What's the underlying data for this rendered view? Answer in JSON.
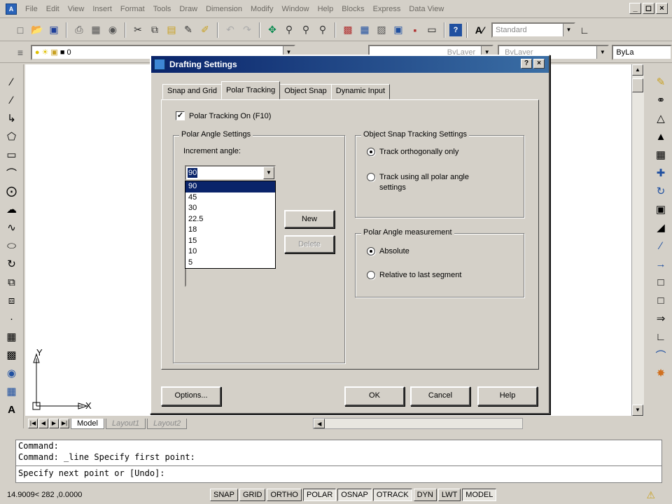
{
  "menu": {
    "items": [
      "File",
      "Edit",
      "View",
      "Insert",
      "Format",
      "Tools",
      "Draw",
      "Dimension",
      "Modify",
      "Window",
      "Help",
      "Blocks",
      "Express",
      "Data View"
    ]
  },
  "window_buttons": [
    "_",
    "&#9723;",
    "×"
  ],
  "toolbar": {
    "text_style_value": "Standard"
  },
  "layers": {
    "layer_name": "0",
    "color_value": "ByLayer",
    "linetype_value": "ByLayer",
    "lineweight_value": "ByLa"
  },
  "ucs": {
    "y_label": "Y",
    "x_label": "X"
  },
  "layout_tabs": [
    {
      "label": "Model",
      "active": true
    },
    {
      "label": "Layout1",
      "active": false
    },
    {
      "label": "Layout2",
      "active": false
    }
  ],
  "command": {
    "lines": [
      "Command:",
      "Command: _line Specify first point:"
    ],
    "prompt": "Specify next point or [Undo]:"
  },
  "status": {
    "coords": "14.9009< 282   ,0.0000",
    "buttons": [
      {
        "label": "SNAP",
        "on": false
      },
      {
        "label": "GRID",
        "on": false
      },
      {
        "label": "ORTHO",
        "on": false
      },
      {
        "label": "POLAR",
        "on": true
      },
      {
        "label": "OSNAP",
        "on": true
      },
      {
        "label": "OTRACK",
        "on": true
      },
      {
        "label": "DYN",
        "on": false
      },
      {
        "label": "LWT",
        "on": false
      },
      {
        "label": "MODEL",
        "on": true
      }
    ]
  },
  "dialog": {
    "title": "Drafting Settings",
    "help_btn": "?",
    "close_btn": "×",
    "tabs": [
      {
        "label": "Snap and Grid",
        "active": false
      },
      {
        "label": "Polar Tracking",
        "active": true
      },
      {
        "label": "Object Snap",
        "active": false
      },
      {
        "label": "Dynamic Input",
        "active": false
      }
    ],
    "polar_on_label": "Polar Tracking On (F10)",
    "polar_on_checked": true,
    "polar_angle_group": {
      "title": "Polar Angle Settings",
      "increment_label": "Increment angle:",
      "increment_value": "90",
      "options": [
        "90",
        "45",
        "30",
        "22.5",
        "18",
        "15",
        "10",
        "5"
      ],
      "selected_index": 0,
      "new_btn": "New",
      "delete_btn": "Delete"
    },
    "osnap_group": {
      "title": "Object Snap Tracking Settings",
      "opt1": "Track orthogonally only",
      "opt2": "Track using all polar angle settings",
      "selected": 1
    },
    "measure_group": {
      "title": "Polar Angle measurement",
      "opt1": "Absolute",
      "opt2": "Relative to last segment",
      "selected": 1
    },
    "options_btn": "Options...",
    "ok_btn": "OK",
    "cancel_btn": "Cancel",
    "help_footer_btn": "Help"
  }
}
